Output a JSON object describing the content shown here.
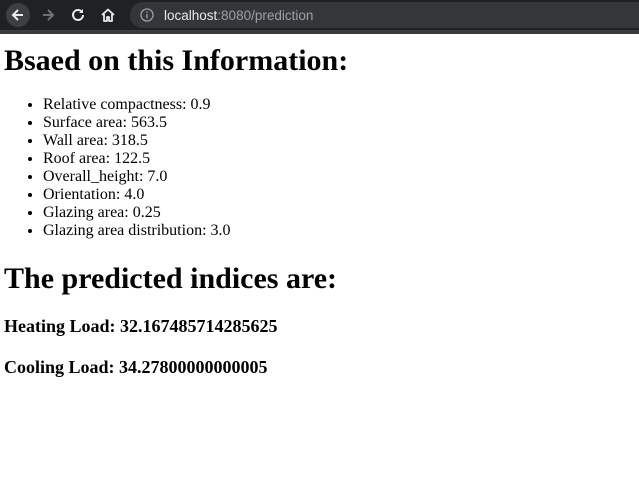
{
  "browser": {
    "url_host": "localhost",
    "url_rest": ":8080/prediction",
    "icons": [
      "back-arrow-icon",
      "forward-arrow-icon",
      "reload-icon",
      "home-icon",
      "info-icon"
    ]
  },
  "page": {
    "heading1": "Bsaed on this Information:",
    "info_items": [
      "Relative compactness: 0.9",
      "Surface area: 563.5",
      "Wall area: 318.5",
      "Roof area: 122.5",
      "Overall_height: 7.0",
      "Orientation: 4.0",
      "Glazing area: 0.25",
      "Glazing area distribution: 3.0"
    ],
    "heading2": "The predicted indices are:",
    "heating_load": "Heating Load: 32.167485714285625",
    "cooling_load": "Cooling Load: 34.27800000000005"
  }
}
